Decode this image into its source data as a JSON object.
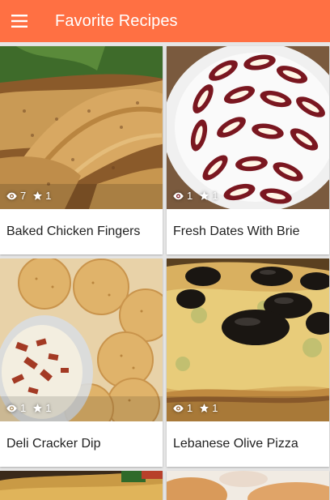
{
  "app_bar": {
    "title": "Favorite Recipes",
    "color": "#ff7043",
    "menu_icon": "hamburger-menu-icon"
  },
  "recipes": [
    {
      "title": "Baked Chicken Fingers",
      "views": "7",
      "favorites": "1"
    },
    {
      "title": "Fresh Dates With Brie",
      "views": "1",
      "favorites": "1"
    },
    {
      "title": "Deli Cracker Dip",
      "views": "1",
      "favorites": "1"
    },
    {
      "title": "Lebanese Olive Pizza",
      "views": "1",
      "favorites": "1"
    }
  ]
}
